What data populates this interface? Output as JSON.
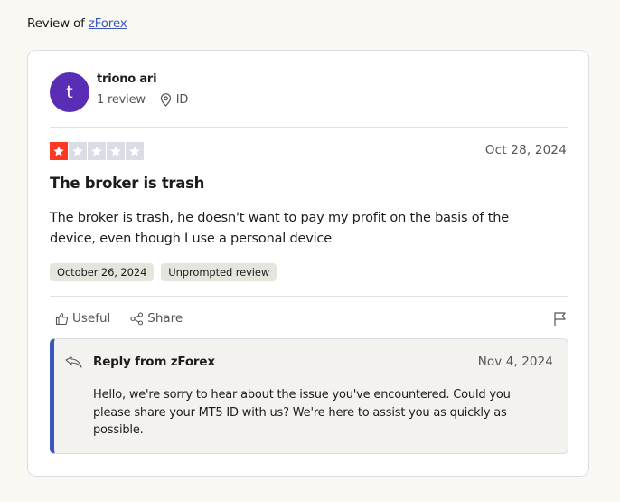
{
  "header": {
    "prefix": "Review of",
    "company_link": "zForex"
  },
  "reviewer": {
    "initial": "t",
    "name": "triono ari",
    "review_count": "1 review",
    "country": "ID",
    "avatar_color": "#5a2db5"
  },
  "review": {
    "rating": 1,
    "rating_max": 5,
    "date": "Oct 28, 2024",
    "title": "The broker is trash",
    "body": "The broker is trash, he doesn't want to pay my profit on the basis of the device, even though I use a personal device",
    "tags": [
      "October 26, 2024",
      "Unprompted review"
    ],
    "star_color": "#ff3722"
  },
  "actions": {
    "useful_label": "Useful",
    "share_label": "Share"
  },
  "reply": {
    "title": "Reply from zForex",
    "date": "Nov 4, 2024",
    "body": "Hello, we're sorry to hear about the issue you've encountered. Could you please share your MT5 ID with us? We're here to assist you as quickly as possible.",
    "accent_color": "#3c57bc"
  }
}
